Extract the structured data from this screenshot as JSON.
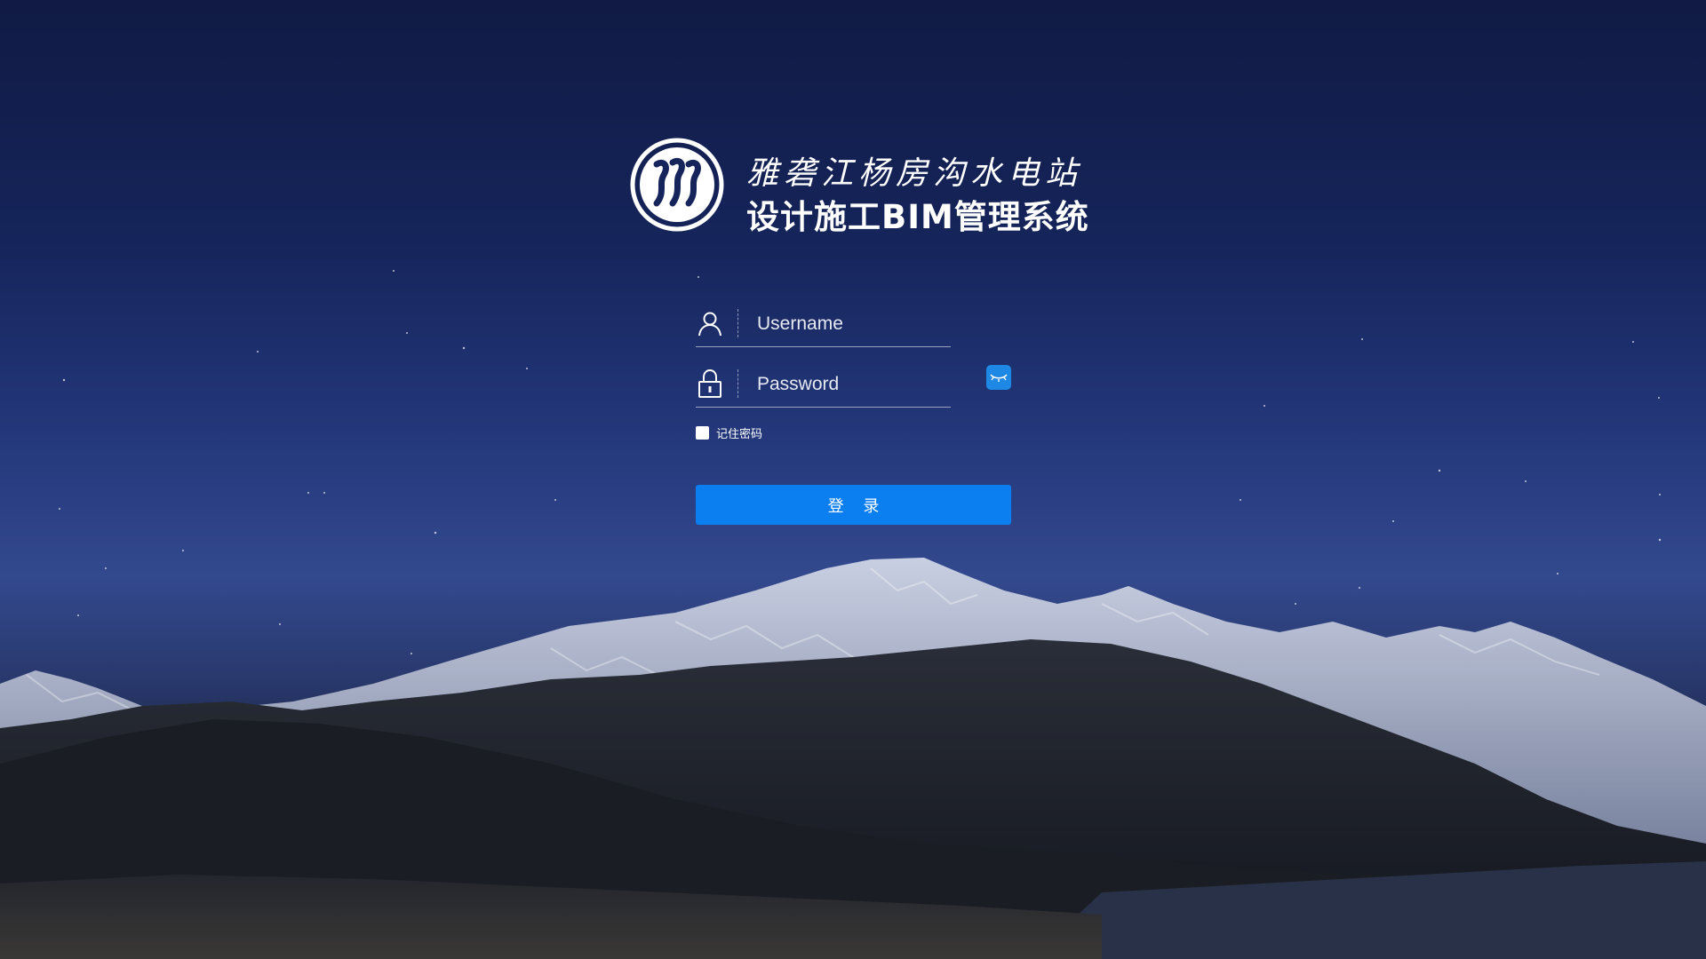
{
  "header": {
    "title_line1": "雅砻江杨房沟水电站",
    "title_line2": "设计施工BIM管理系统"
  },
  "form": {
    "username_placeholder": "Username",
    "password_placeholder": "Password",
    "remember_label": "记住密码",
    "login_label": "登 录"
  },
  "colors": {
    "primary_button": "#0b7ef0",
    "eye_toggle": "#1e88e5",
    "sky_top": "#101a44"
  },
  "icons": {
    "logo": "hydropower-logo",
    "username": "user-icon",
    "password": "lock-icon",
    "toggle": "eye-closed-icon"
  }
}
